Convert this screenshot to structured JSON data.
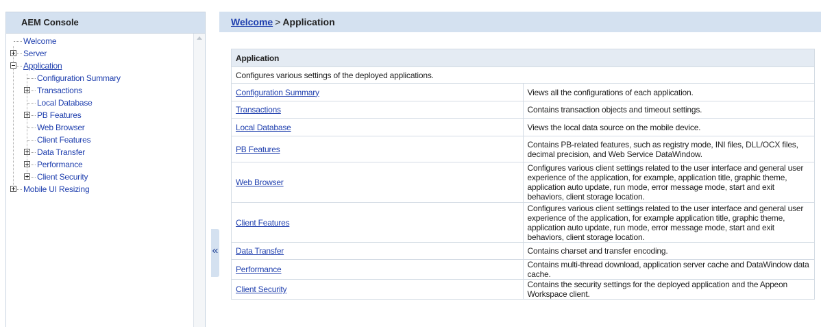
{
  "console": {
    "title": "AEM Console"
  },
  "tree": {
    "items": [
      {
        "label": "Welcome"
      },
      {
        "label": "Server"
      },
      {
        "label": "Application"
      },
      {
        "label": "Configuration Summary"
      },
      {
        "label": "Transactions"
      },
      {
        "label": "Local Database"
      },
      {
        "label": "PB Features"
      },
      {
        "label": "Web Browser"
      },
      {
        "label": "Client Features"
      },
      {
        "label": "Data Transfer"
      },
      {
        "label": "Performance"
      },
      {
        "label": "Client Security"
      },
      {
        "label": "Mobile UI Resizing"
      }
    ]
  },
  "collapse": {
    "glyph": "«"
  },
  "breadcrumb": {
    "root": "Welcome",
    "separator": ">",
    "current": "Application"
  },
  "section": {
    "heading": "Application",
    "description": "Configures various settings of the deployed applications.",
    "rows": [
      {
        "name": "Configuration Summary",
        "desc": "Views all the configurations of each application."
      },
      {
        "name": "Transactions",
        "desc": "Contains transaction objects and timeout settings."
      },
      {
        "name": "Local Database",
        "desc": "Views the local data source on the mobile device."
      },
      {
        "name": "PB Features",
        "desc": "Contains PB-related features, such as registry mode, INI files, DLL/OCX files, decimal precision, and Web Service DataWindow."
      },
      {
        "name": "Web Browser",
        "desc": "Configures various client settings related to the user interface and general user experience of the application, for example, application title, graphic theme, application auto update, run mode, error message mode, start and exit behaviors, client storage location."
      },
      {
        "name": "Client Features",
        "desc": "Configures various client settings related to the user interface and general user experience of the application, for example application title, graphic theme, application auto update, run mode, error message mode, start and exit behaviors, client storage location."
      },
      {
        "name": "Data Transfer",
        "desc": "Contains charset and transfer encoding."
      },
      {
        "name": "Performance",
        "desc": "Contains multi-thread download, application server cache and DataWindow data cache."
      },
      {
        "name": "Client Security",
        "desc": "Contains the security settings for the deployed application and the Appeon Workspace client."
      }
    ]
  }
}
